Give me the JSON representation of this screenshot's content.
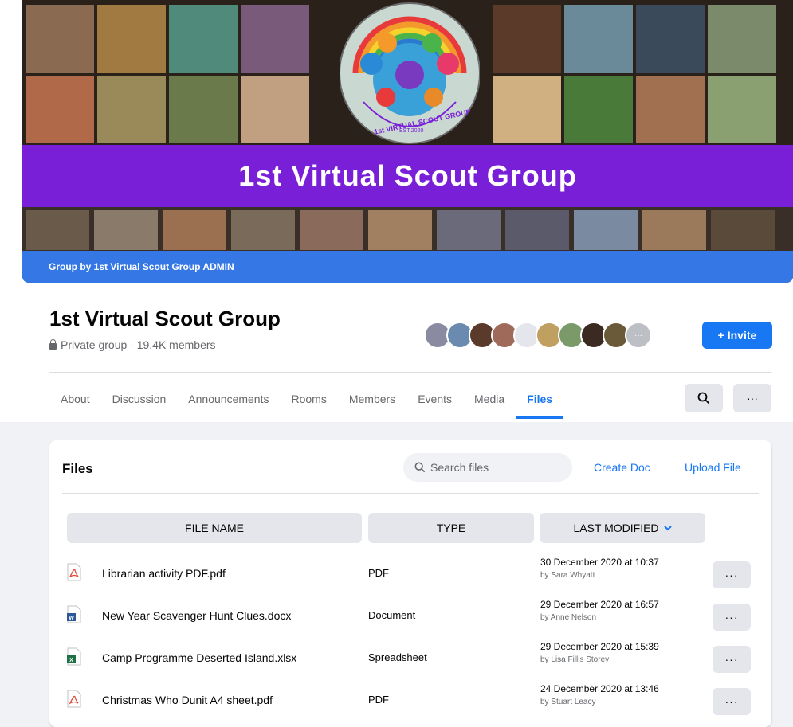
{
  "cover": {
    "banner_text": "1st Virtual Scout Group",
    "owner_line": "Group by 1st Virtual Scout Group ADMIN",
    "logo_text_arc": "1st VIRTUAL SCOUT GROUP",
    "logo_est": "EST.2020"
  },
  "group": {
    "name": "1st Virtual Scout Group",
    "meta": "Private group · 19.4K members",
    "invite_label": "+ Invite"
  },
  "tabs": [
    {
      "label": "About"
    },
    {
      "label": "Discussion"
    },
    {
      "label": "Announcements"
    },
    {
      "label": "Rooms"
    },
    {
      "label": "Members"
    },
    {
      "label": "Events"
    },
    {
      "label": "Media"
    },
    {
      "label": "Files"
    }
  ],
  "active_tab": "Files",
  "files": {
    "title": "Files",
    "search_placeholder": "Search files",
    "create_doc": "Create Doc",
    "upload_file": "Upload File",
    "columns": {
      "name": "FILE NAME",
      "type": "TYPE",
      "modified": "LAST MODIFIED"
    },
    "rows": [
      {
        "name": "Librarian activity PDF.pdf",
        "type": "PDF",
        "icon": "pdf-icon",
        "date": "30 December 2020 at 10:37",
        "by": "by Sara Whyatt"
      },
      {
        "name": "New Year Scavenger Hunt Clues.docx",
        "type": "Document",
        "icon": "word-doc-icon",
        "date": "29 December 2020 at 16:57",
        "by": "by Anne Nelson"
      },
      {
        "name": "Camp Programme Deserted Island.xlsx",
        "type": "Spreadsheet",
        "icon": "excel-icon",
        "date": "29 December 2020 at 15:39",
        "by": "by Lisa Fillis Storey"
      },
      {
        "name": "Christmas Who Dunit A4 sheet.pdf",
        "type": "PDF",
        "icon": "pdf-icon",
        "date": "24 December 2020 at 13:46",
        "by": "by Stuart Leacy"
      }
    ],
    "more_label": "···"
  },
  "colors": {
    "accent": "#1877f2",
    "banner_purple": "#7a1fd8",
    "owner_bar_blue": "#3578e5"
  }
}
